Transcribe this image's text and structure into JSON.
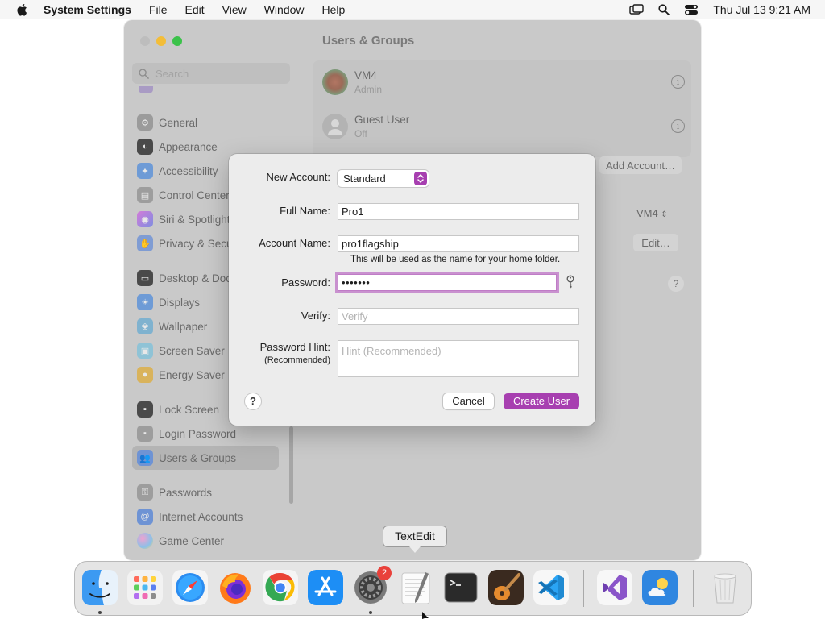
{
  "menubar": {
    "app_name": "System Settings",
    "items": [
      "File",
      "Edit",
      "View",
      "Window",
      "Help"
    ],
    "clock": "Thu Jul 13  9:21 AM"
  },
  "window": {
    "title": "Users & Groups",
    "search_placeholder": "Search"
  },
  "sidebar": {
    "items": [
      {
        "label": "General",
        "icon": "gear-icon",
        "color": "#8e8e93"
      },
      {
        "label": "Appearance",
        "icon": "appearance-icon",
        "color": "#1c1c1e"
      },
      {
        "label": "Accessibility",
        "icon": "accessibility-icon",
        "color": "#0a84ff"
      },
      {
        "label": "Control Center",
        "icon": "control-center-icon",
        "color": "#8e8e93"
      },
      {
        "label": "Siri & Spotlight",
        "icon": "siri-icon",
        "color": "#c45bd9"
      },
      {
        "label": "Privacy & Security",
        "icon": "hand-icon",
        "color": "#3478f6"
      },
      {
        "label": "Desktop & Dock",
        "icon": "dock-icon",
        "color": "#1c1c1e"
      },
      {
        "label": "Displays",
        "icon": "sun-icon",
        "color": "#0a84ff"
      },
      {
        "label": "Wallpaper",
        "icon": "wallpaper-icon",
        "color": "#35aadc"
      },
      {
        "label": "Screen Saver",
        "icon": "screen-saver-icon",
        "color": "#5ac8e6"
      },
      {
        "label": "Energy Saver",
        "icon": "bulb-icon",
        "color": "#f4b400"
      },
      {
        "label": "Lock Screen",
        "icon": "lock-icon",
        "color": "#1c1c1e"
      },
      {
        "label": "Login Password",
        "icon": "lock-icon",
        "color": "#8e8e93"
      },
      {
        "label": "Users & Groups",
        "icon": "users-icon",
        "color": "#2f7cf6"
      },
      {
        "label": "Passwords",
        "icon": "key-icon",
        "color": "#8e8e93"
      },
      {
        "label": "Internet Accounts",
        "icon": "at-icon",
        "color": "#2f7cf6"
      },
      {
        "label": "Game Center",
        "icon": "game-center-icon",
        "color": "#ff5f6d"
      }
    ]
  },
  "users": [
    {
      "name": "VM4",
      "role": "Admin"
    },
    {
      "name": "Guest User",
      "role": "Off"
    }
  ],
  "background_controls": {
    "add_account": "Add Account…",
    "auto_login_value": "VM4",
    "edit": "Edit…",
    "help": "?"
  },
  "sheet": {
    "new_account_label": "New Account:",
    "account_type": "Standard",
    "full_name_label": "Full Name:",
    "full_name_value": "Pro1",
    "account_name_label": "Account Name:",
    "account_name_value": "pro1flagship",
    "account_name_help": "This will be used as the name for your home folder.",
    "password_label": "Password:",
    "password_value": "•••••••",
    "verify_label": "Verify:",
    "verify_placeholder": "Verify",
    "hint_label": "Password Hint:",
    "hint_sublabel": "(Recommended)",
    "hint_placeholder": "Hint (Recommended)",
    "help": "?",
    "cancel": "Cancel",
    "create": "Create User",
    "accent": "#a73fb0"
  },
  "dock": {
    "tooltip": "TextEdit",
    "badge": "2",
    "apps": [
      "Finder",
      "Launchpad",
      "Safari",
      "Firefox",
      "Chrome",
      "App Store",
      "System Settings",
      "TextEdit",
      "Terminal",
      "GarageBand",
      "Visual Studio Code",
      "Visual Studio",
      "Weather",
      "Trash"
    ]
  }
}
